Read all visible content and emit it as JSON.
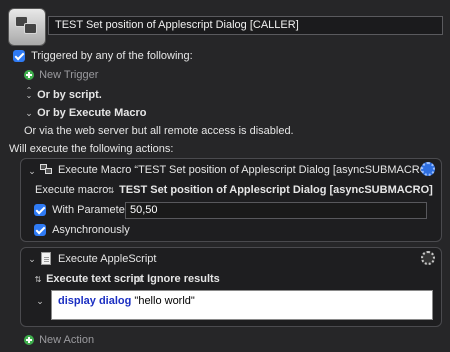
{
  "header": {
    "title": "TEST Set position of Applescript Dialog [CALLER]"
  },
  "triggers": {
    "triggered_label": "Triggered by any of the following:",
    "new_trigger": "New Trigger",
    "by_script": "Or by script.",
    "by_execute_macro": "Or by Execute Macro",
    "web_server_note": "Or via the web server but all remote access is disabled."
  },
  "actions_heading": "Will execute the following actions:",
  "action1": {
    "title": "Execute Macro “TEST Set position of Applescript Dialog [asyncSUBMACRO]”...",
    "macro_label": "Execute macro:",
    "macro_value": "TEST Set position of Applescript Dialog [asyncSUBMACRO]",
    "with_parameter_label": "With Parameter",
    "parameter_value": "50,50",
    "async_label": "Asynchronously"
  },
  "action2": {
    "title": "Execute AppleScript",
    "execute_option": "Execute text script",
    "results_option": "Ignore results",
    "script_keyword": "display dialog",
    "script_string": "\"hello world\""
  },
  "footer": {
    "new_action": "New Action"
  },
  "colors": {
    "background": "#262628",
    "accent_blue": "#2f7bf5",
    "add_green": "#3fae4d",
    "keyword_blue": "#1b2fc2"
  }
}
